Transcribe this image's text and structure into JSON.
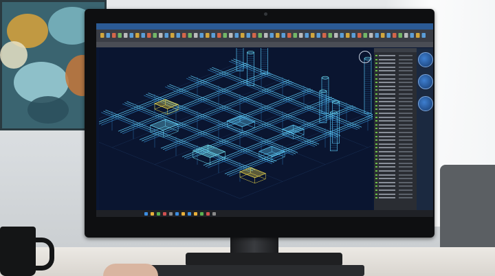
{
  "colors": {
    "wire": "#5fd0ff",
    "wire_dim": "#2e7fc0",
    "highlight": "#7af0ff",
    "accent_yellow": "#f6e04a",
    "accent_green": "#6ec24a"
  },
  "scene": {
    "painting": {
      "icon": "abstract-painting"
    },
    "mug": {
      "icon": "coffee-mug"
    },
    "keyboard": {
      "icon": "keyboard"
    },
    "hand": {
      "icon": "hand"
    }
  },
  "monitor": {
    "screen": {
      "window_title": "",
      "model_tree": [],
      "properties_panel": {
        "title": "",
        "rows": []
      },
      "nav_label": "",
      "compass_label": "",
      "status_text": ""
    }
  }
}
